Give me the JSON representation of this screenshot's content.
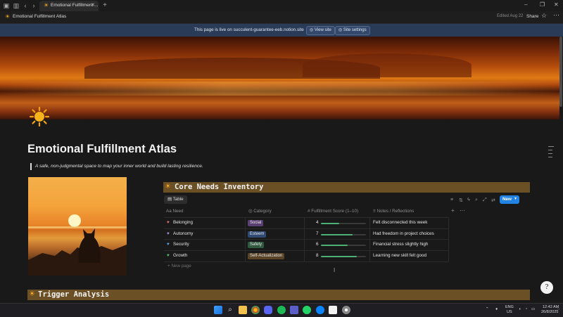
{
  "browser": {
    "tab_title": "Emotional Fulfillment ...",
    "new_tab": "+"
  },
  "header": {
    "page_name": "Emotional Fulfillment Atlas",
    "edited": "Edited Aug 22",
    "share": "Share"
  },
  "banner": {
    "text": "This page is live on succulent-guarantee-eeb.notion.site",
    "view_site": "View site",
    "site_settings": "Site settings"
  },
  "page": {
    "title": "Emotional Fulfillment Atlas",
    "quote": "A safe, non-judgmental space to map your inner world and build lasting resilience."
  },
  "database": {
    "title": "Core Needs Inventory",
    "view_label": "Table",
    "new_button": "New",
    "columns": [
      "Need",
      "Category",
      "Fulfillment Score (1–10)",
      "Notes / Reflections"
    ],
    "rows": [
      {
        "need": "Belonging",
        "heart_color": "#e0726a",
        "category": "Social",
        "tag_color": "#5a3f73",
        "score": "4",
        "fraction": 0.4,
        "note": "Felt disconnected this week"
      },
      {
        "need": "Autonomy",
        "heart_color": "#a78bd6",
        "category": "Esteem",
        "tag_color": "#2f4a73",
        "score": "7",
        "fraction": 0.7,
        "note": "Had freedom in project choices"
      },
      {
        "need": "Security",
        "heart_color": "#5aa3e0",
        "category": "Safety",
        "tag_color": "#2f5a3f",
        "score": "6",
        "fraction": 0.6,
        "note": "Financial stress slightly high"
      },
      {
        "need": "Growth",
        "heart_color": "#58c26a",
        "category": "Self-Actualization",
        "tag_color": "#5a4326",
        "score": "8",
        "fraction": 0.8,
        "note": "Learning new skill felt good"
      }
    ],
    "new_page": "New page"
  },
  "section2": {
    "title": "Trigger Analysis"
  },
  "help": {
    "label": "?"
  },
  "tray": {
    "lang": "ENG",
    "region": "US",
    "time": "12:42 AM",
    "date": "26/8/2025"
  },
  "colors": {
    "accent": "#2383e2",
    "band": "#6b4f25",
    "banner": "#2a3b57"
  }
}
